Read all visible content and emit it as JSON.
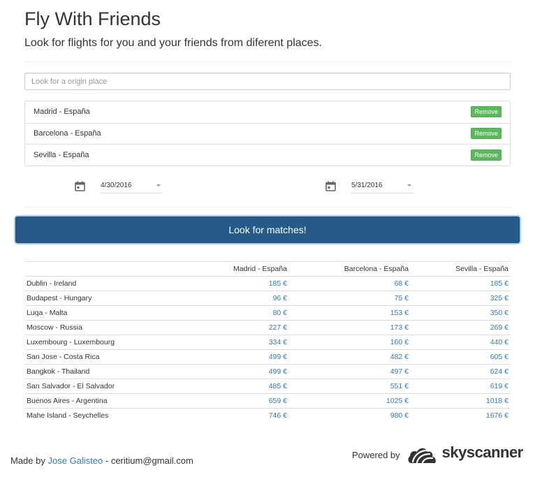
{
  "header": {
    "title": "Fly With Friends",
    "subtitle": "Look for flights for you and your friends from diferent places."
  },
  "search": {
    "placeholder": "Look for a origin place",
    "value": ""
  },
  "origins": [
    {
      "label": "Madrid - España",
      "remove_label": "Remove"
    },
    {
      "label": "Barcelona - España",
      "remove_label": "Remove"
    },
    {
      "label": "Sevilla - España",
      "remove_label": "Remove"
    }
  ],
  "dates": {
    "departure": "4/30/2016",
    "return": "5/31/2016"
  },
  "actions": {
    "match_label": "Look for matches!"
  },
  "results": {
    "headers": [
      "",
      "Madrid - España",
      "Barcelona - España",
      "Sevilla - España"
    ],
    "rows": [
      {
        "destination": "Dublin - Ireland",
        "prices": [
          "185 €",
          "68 €",
          "185 €"
        ]
      },
      {
        "destination": "Budapest - Hungary",
        "prices": [
          "96 €",
          "75 €",
          "325 €"
        ]
      },
      {
        "destination": "Luqa - Malta",
        "prices": [
          "80 €",
          "153 €",
          "350 €"
        ]
      },
      {
        "destination": "Moscow - Russia",
        "prices": [
          "227 €",
          "173 €",
          "269 €"
        ]
      },
      {
        "destination": "Luxembourg - Luxembourg",
        "prices": [
          "334 €",
          "160 €",
          "440 €"
        ]
      },
      {
        "destination": "San Jose - Costa Rica",
        "prices": [
          "499 €",
          "482 €",
          "605 €"
        ]
      },
      {
        "destination": "Bangkok - Thailand",
        "prices": [
          "499 €",
          "497 €",
          "624 €"
        ]
      },
      {
        "destination": "San Salvador - El Salvador",
        "prices": [
          "485 €",
          "551 €",
          "619 €"
        ]
      },
      {
        "destination": "Buenos Aires - Argentina",
        "prices": [
          "659 €",
          "1025 €",
          "1018 €"
        ]
      },
      {
        "destination": "Mahe Island - Seychelles",
        "prices": [
          "746 €",
          "980 €",
          "1676 €"
        ]
      }
    ]
  },
  "footer": {
    "made_by": "Made by",
    "author": "Jose Galisteo",
    "email_sep": "- ceritium@gmail.com",
    "powered_by": "Powered by",
    "brand": "skyscanner"
  },
  "colors": {
    "primary_button": "#265a88",
    "remove_button": "#5cb85c",
    "link": "#337ab7"
  },
  "icons": {
    "calendar": "calendar-icon",
    "brand_logo": "skyscanner-cloud-logo"
  }
}
